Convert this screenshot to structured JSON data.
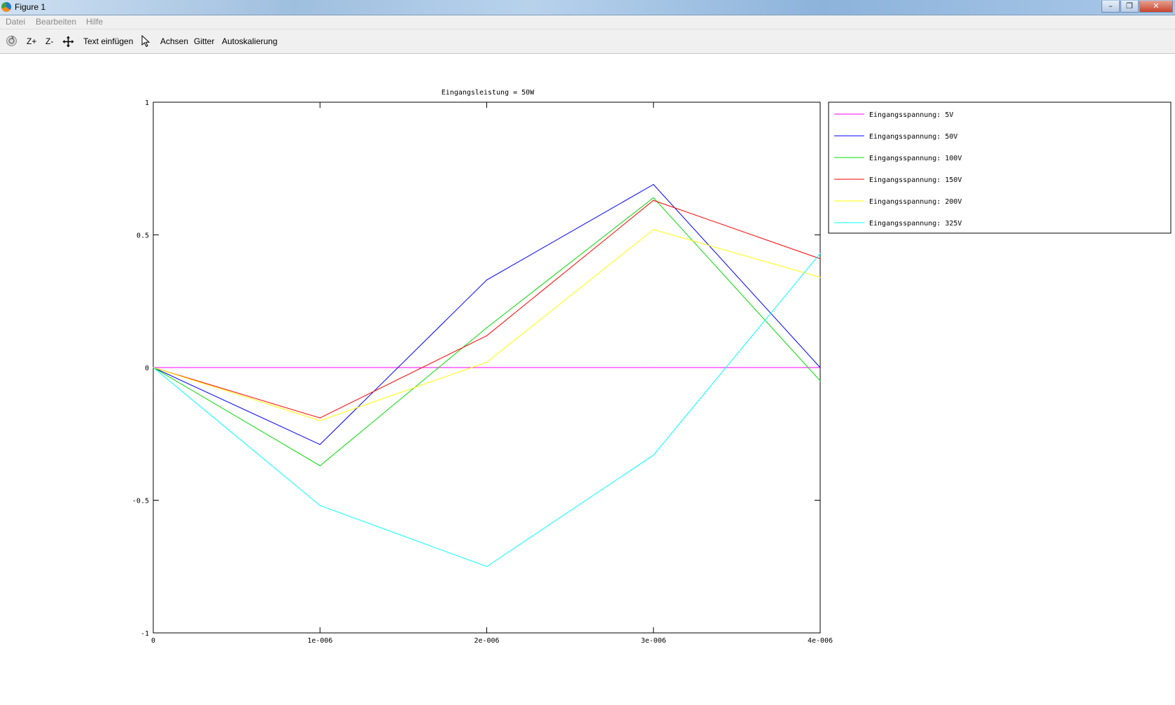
{
  "window": {
    "title": "Figure 1"
  },
  "menubar": {
    "items": [
      "Datei",
      "Bearbeiten",
      "Hilfe"
    ]
  },
  "toolbar": {
    "zoom_in_label": "Z+",
    "zoom_out_label": "Z-",
    "insert_text_label": "Text einfügen",
    "axes_label": "Achsen",
    "grid_label": "Gitter",
    "autoscale_label": "Autoskalierung"
  },
  "chart_data": {
    "type": "line",
    "title": "Eingangsleistung = 50W",
    "xlabel": "",
    "ylabel": "",
    "x": [
      0,
      1e-06,
      2e-06,
      3e-06,
      4e-06
    ],
    "xlim": [
      0,
      4e-06
    ],
    "ylim": [
      -1,
      1
    ],
    "xticks": [
      "0",
      "1e-006",
      "2e-006",
      "3e-006",
      "4e-006"
    ],
    "yticks": [
      "1",
      "0.5",
      "0",
      "-0.5",
      "-1"
    ],
    "ytick_values": [
      1,
      0.5,
      0,
      -0.5,
      -1
    ],
    "grid": false,
    "legend_position": "outside-right",
    "series": [
      {
        "name": "Eingangsspannung: 5V",
        "color": "#ff00ff",
        "values": [
          0,
          0,
          0,
          0,
          0
        ]
      },
      {
        "name": "Eingangsspannung: 50V",
        "color": "#0000ff",
        "values": [
          0,
          -0.29,
          0.33,
          0.69,
          0.0
        ]
      },
      {
        "name": "Eingangsspannung: 100V",
        "color": "#00dd00",
        "values": [
          0,
          -0.37,
          0.15,
          0.64,
          -0.05
        ]
      },
      {
        "name": "Eingangsspannung: 150V",
        "color": "#ff0000",
        "values": [
          0,
          -0.19,
          0.12,
          0.63,
          0.41
        ]
      },
      {
        "name": "Eingangsspannung: 200V",
        "color": "#ffff00",
        "values": [
          0,
          -0.2,
          0.02,
          0.52,
          0.34
        ]
      },
      {
        "name": "Eingangsspannung: 325V",
        "color": "#00ffff",
        "values": [
          0,
          -0.52,
          -0.75,
          -0.33,
          0.43
        ]
      }
    ]
  }
}
